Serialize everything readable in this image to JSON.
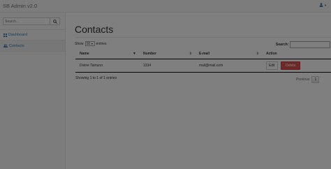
{
  "navbar": {
    "brand": "SB Admin v2.0"
  },
  "sidebar": {
    "search_placeholder": "Search...",
    "items": [
      {
        "label": "Dashboard",
        "icon": "dashboard-icon"
      },
      {
        "label": "Contacts",
        "icon": "users-icon"
      }
    ]
  },
  "main": {
    "title": "Contacts",
    "length_prefix": "Show",
    "length_value": "10",
    "length_suffix": "entries",
    "search_label": "Search:",
    "columns": [
      "Name",
      "Number",
      "E-mail",
      "Action"
    ],
    "rows": [
      {
        "name": "Divine Tamuno",
        "number": "1334",
        "email": "mail@mail.com",
        "edit": "Edit",
        "delete": "Delete"
      }
    ],
    "info": "Showing 1 to 1 of 1 entries",
    "prev": "Previous",
    "page": "1"
  },
  "colors": {
    "link": "#337ab7",
    "danger": "#d9534f",
    "overlay": "rgba(0,0,0,0.5)"
  }
}
